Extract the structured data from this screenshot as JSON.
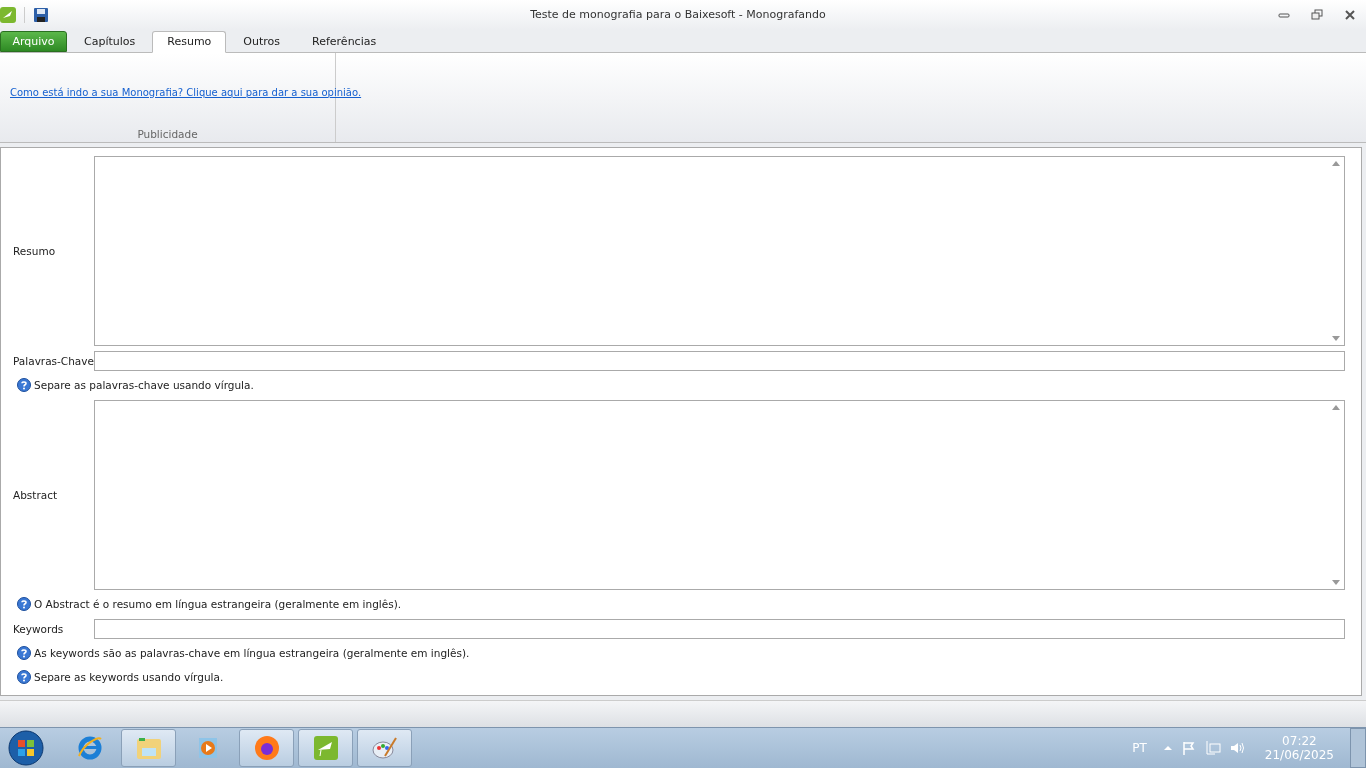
{
  "window": {
    "title": "Teste de monografia para o Baixesoft - Monografando"
  },
  "file_tab": {
    "label": "Arquivo"
  },
  "tabs": [
    {
      "label": "Capítulos",
      "selected": false
    },
    {
      "label": "Resumo",
      "selected": true
    },
    {
      "label": "Outros",
      "selected": false
    },
    {
      "label": "Referências",
      "selected": false
    }
  ],
  "ribbon": {
    "link": "Como está indo a sua Monografia? Clique aqui para dar a sua opinião.",
    "group_label": "Publicidade"
  },
  "form": [
    {
      "kind": "textarea",
      "label": "Resumo"
    },
    {
      "kind": "input",
      "label": "Palavras-Chave"
    },
    {
      "kind": "hint",
      "text": "Separe as palavras-chave usando vírgula."
    },
    {
      "kind": "textarea",
      "label": "Abstract"
    },
    {
      "kind": "hint",
      "text": "O Abstract é o resumo em língua estrangeira (geralmente em inglês)."
    },
    {
      "kind": "input",
      "label": "Keywords"
    },
    {
      "kind": "hint",
      "text": "As keywords são as palavras-chave em língua estrangeira (geralmente em inglês)."
    },
    {
      "kind": "hint",
      "text": "Separe as keywords usando vírgula."
    }
  ],
  "taskbar": {
    "apps": [
      {
        "kind": "ie",
        "running": false
      },
      {
        "kind": "folder",
        "running": true
      },
      {
        "kind": "media",
        "running": false
      },
      {
        "kind": "firefox",
        "running": true
      },
      {
        "kind": "cap",
        "running": true
      },
      {
        "kind": "paint",
        "running": true
      }
    ],
    "language": "PT",
    "time": "07:22",
    "date": "21/06/2025"
  }
}
